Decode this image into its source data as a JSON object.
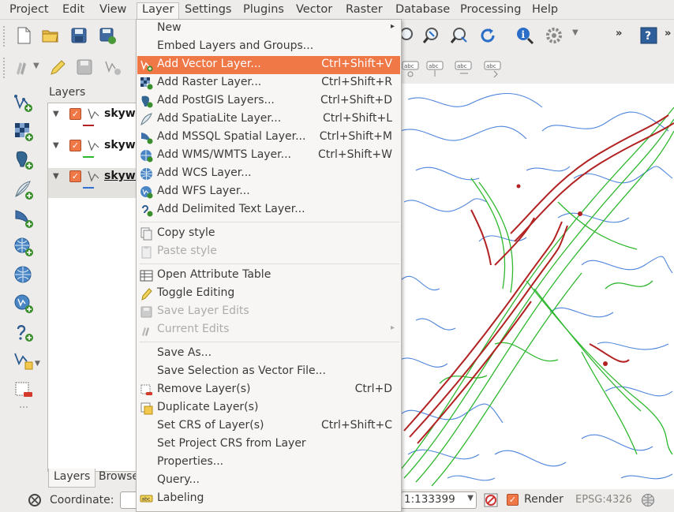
{
  "menubar": {
    "items": [
      {
        "label": "Project"
      },
      {
        "label": "Edit"
      },
      {
        "label": "View"
      },
      {
        "label": "Layer"
      },
      {
        "label": "Settings"
      },
      {
        "label": "Plugins"
      },
      {
        "label": "Vector"
      },
      {
        "label": "Raster"
      },
      {
        "label": "Database"
      },
      {
        "label": "Processing"
      },
      {
        "label": "Help"
      }
    ],
    "active": "Layer"
  },
  "layer_menu": {
    "items": [
      {
        "label": "New",
        "shortcut": "",
        "arrow": "▸",
        "icon": "none"
      },
      {
        "label": "Embed Layers and Groups...",
        "shortcut": "",
        "icon": "none"
      },
      {
        "label": "Add Vector Layer...",
        "shortcut": "Ctrl+Shift+V",
        "icon": "add-vector-icon",
        "highlighted": true
      },
      {
        "label": "Add Raster Layer...",
        "shortcut": "Ctrl+Shift+R",
        "icon": "add-raster-icon"
      },
      {
        "label": "Add PostGIS Layers...",
        "shortcut": "Ctrl+Shift+D",
        "icon": "add-postgis-icon"
      },
      {
        "label": "Add SpatiaLite Layer...",
        "shortcut": "Ctrl+Shift+L",
        "icon": "add-spatialite-icon"
      },
      {
        "label": "Add MSSQL Spatial Layer...",
        "shortcut": "Ctrl+Shift+M",
        "icon": "add-mssql-icon"
      },
      {
        "label": "Add WMS/WMTS Layer...",
        "shortcut": "Ctrl+Shift+W",
        "icon": "add-wms-icon"
      },
      {
        "label": "Add WCS Layer...",
        "shortcut": "",
        "icon": "add-wcs-icon"
      },
      {
        "label": "Add WFS Layer...",
        "shortcut": "",
        "icon": "add-wfs-icon"
      },
      {
        "label": "Add Delimited Text Layer...",
        "shortcut": "",
        "icon": "add-delimited-text-icon"
      },
      {
        "label": "Copy style",
        "shortcut": "",
        "icon": "copy-style-icon"
      },
      {
        "label": "Paste style",
        "shortcut": "",
        "icon": "paste-style-icon",
        "disabled": true
      },
      {
        "label": "Open Attribute Table",
        "shortcut": "",
        "icon": "attribute-table-icon"
      },
      {
        "label": "Toggle Editing",
        "shortcut": "",
        "icon": "pencil-icon"
      },
      {
        "label": "Save Layer Edits",
        "shortcut": "",
        "icon": "save-edits-icon",
        "disabled": true
      },
      {
        "label": "Current Edits",
        "shortcut": "",
        "arrow": "▸",
        "icon": "current-edits-icon",
        "disabled": true
      },
      {
        "label": "Save As...",
        "shortcut": "",
        "icon": "none"
      },
      {
        "label": "Save Selection as Vector File...",
        "shortcut": "",
        "icon": "none"
      },
      {
        "label": "Remove Layer(s)",
        "shortcut": "Ctrl+D",
        "icon": "remove-layer-icon"
      },
      {
        "label": "Duplicate Layer(s)",
        "shortcut": "",
        "icon": "duplicate-layer-icon"
      },
      {
        "label": "Set CRS of Layer(s)",
        "shortcut": "Ctrl+Shift+C",
        "icon": "none"
      },
      {
        "label": "Set Project CRS from Layer",
        "shortcut": "",
        "icon": "none"
      },
      {
        "label": "Properties...",
        "shortcut": "",
        "icon": "none"
      },
      {
        "label": "Query...",
        "shortcut": "",
        "icon": "none"
      },
      {
        "label": "Labeling",
        "shortcut": "",
        "icon": "labeling-icon"
      }
    ]
  },
  "layers_panel": {
    "title": "Layers",
    "layers": [
      {
        "name": "skywa",
        "swatch": "#b22222",
        "checked": true
      },
      {
        "name": "skywa",
        "swatch": "#2eb82e",
        "checked": true
      },
      {
        "name": "skywa",
        "swatch": "#2f6fd6",
        "checked": true,
        "selected": true
      }
    ],
    "tabs": [
      {
        "label": "Layers"
      },
      {
        "label": "Browse"
      }
    ]
  },
  "statusbar": {
    "coordinate_label": "Coordinate:",
    "coordinate_value": "",
    "scale_value": "1:133399",
    "render_label": "Render",
    "crs_label": "EPSG:4326"
  },
  "map": {
    "colors": {
      "contour_red": "#b22222",
      "contour_green": "#2eb82e",
      "contour_blue": "#2f6fd6"
    }
  },
  "colors": {
    "accent": "#f07746"
  }
}
